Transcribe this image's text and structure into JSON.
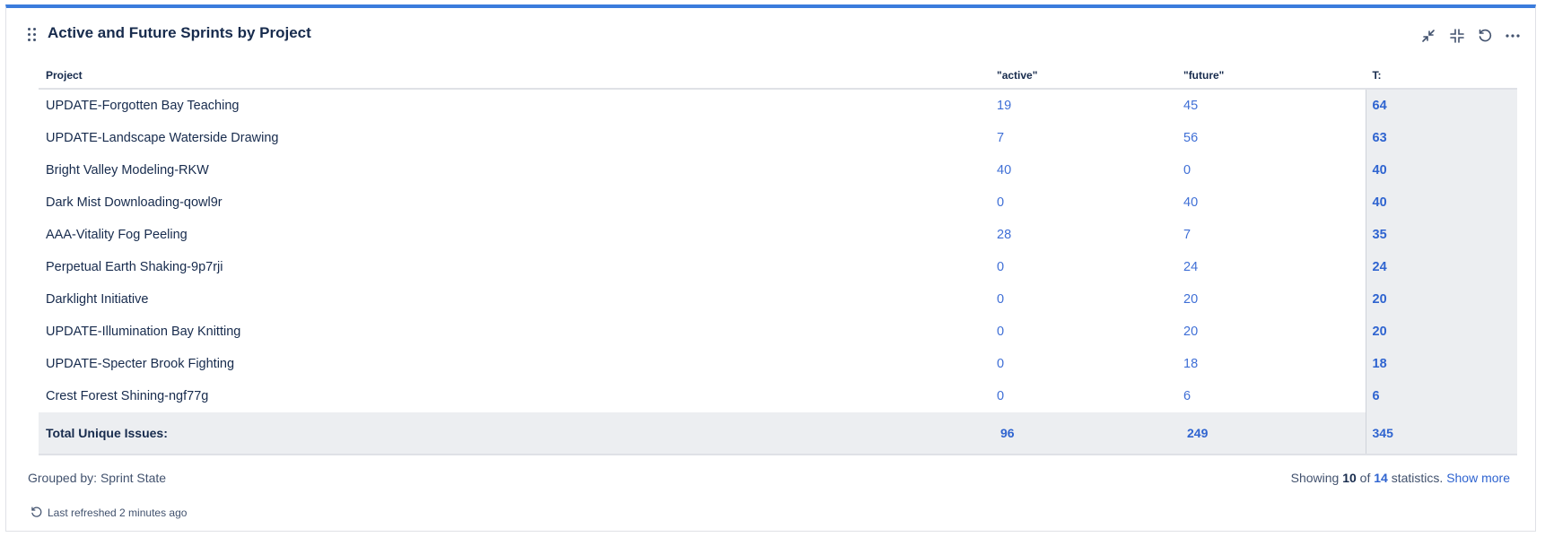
{
  "gadget": {
    "title": "Active and Future Sprints by Project",
    "actions": [
      "minimize-icon",
      "collapse-icon",
      "refresh-icon",
      "more-icon"
    ]
  },
  "table": {
    "headers": {
      "project": "Project",
      "active": "\"active\"",
      "future": "\"future\"",
      "total": "T:"
    },
    "rows": [
      {
        "project": "UPDATE-Forgotten Bay Teaching",
        "active": "19",
        "future": "45",
        "total": "64"
      },
      {
        "project": "UPDATE-Landscape Waterside Drawing",
        "active": "7",
        "future": "56",
        "total": "63"
      },
      {
        "project": "Bright Valley Modeling-RKW",
        "active": "40",
        "future": "0",
        "total": "40"
      },
      {
        "project": "Dark Mist Downloading-qowl9r",
        "active": "0",
        "future": "40",
        "total": "40"
      },
      {
        "project": "AAA-Vitality Fog Peeling",
        "active": "28",
        "future": "7",
        "total": "35"
      },
      {
        "project": "Perpetual Earth Shaking-9p7rji",
        "active": "0",
        "future": "24",
        "total": "24"
      },
      {
        "project": "Darklight Initiative",
        "active": "0",
        "future": "20",
        "total": "20"
      },
      {
        "project": "UPDATE-Illumination Bay Knitting",
        "active": "0",
        "future": "20",
        "total": "20"
      },
      {
        "project": "UPDATE-Specter Brook Fighting",
        "active": "0",
        "future": "18",
        "total": "18"
      },
      {
        "project": "Crest Forest Shining-ngf77g",
        "active": "0",
        "future": "6",
        "total": "6"
      }
    ],
    "totals": {
      "label": "Total Unique Issues:",
      "active": "96",
      "future": "249",
      "total": "345"
    }
  },
  "footer": {
    "grouped_by": "Grouped by: Sprint State",
    "showing_prefix": "Showing",
    "showing_count": "10",
    "showing_of": "of",
    "showing_total": "14",
    "showing_suffix": "statistics.",
    "show_more": "Show more",
    "last_refreshed": "Last refreshed 2 minutes ago"
  },
  "colors": {
    "accent": "#3b7cdc",
    "link": "#2f64d0",
    "total_bg": "#eceef1"
  }
}
